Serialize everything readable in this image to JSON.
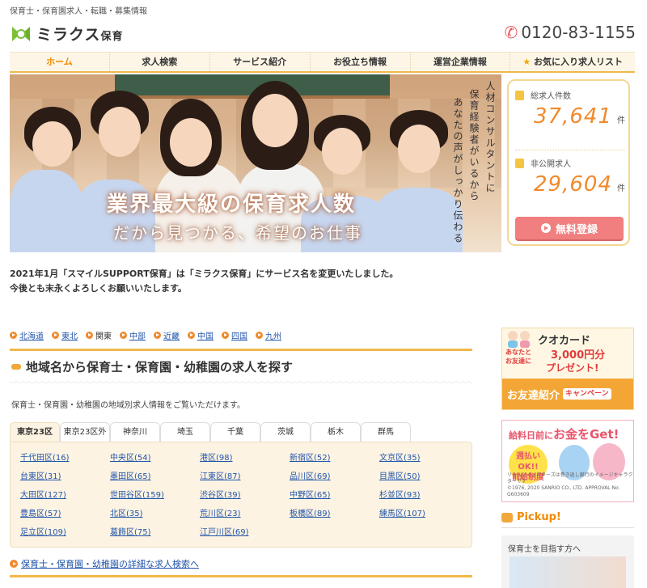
{
  "header": {
    "tagline": "保育士・保育園求人・転職・募集情報",
    "logo_text": "ミラクス",
    "logo_sub": "保育",
    "phone": "0120-83-1155"
  },
  "nav": {
    "items": [
      {
        "label": "ホーム"
      },
      {
        "label": "求人検索"
      },
      {
        "label": "サービス紹介"
      },
      {
        "label": "お役立ち情報"
      },
      {
        "label": "運営企業情報"
      },
      {
        "label": "お気に入り求人リスト"
      }
    ]
  },
  "hero": {
    "title": "業界最大級の保育求人数",
    "subtitle": "だから見つかる、希望のお仕事",
    "vertical": [
      "人材コンサルタントに",
      "保育経験者がいるから",
      "あなたの声がしっかり伝わる"
    ]
  },
  "stats": {
    "total_label": "総求人件数",
    "total_value": "37,641",
    "total_unit": "件",
    "private_label": "非公開求人",
    "private_value": "29,604",
    "private_unit": "件",
    "register_label": "無料登録"
  },
  "notice": {
    "line1": "2021年1月「スマイルSUPPORT保育」は「ミラクス保育」にサービス名を変更いたしました。",
    "line2": "今後とも末永くよろしくお願いいたします。"
  },
  "regions": [
    {
      "label": "北海道",
      "link": true
    },
    {
      "label": "東北",
      "link": true
    },
    {
      "label": "関東",
      "link": false
    },
    {
      "label": "中部",
      "link": true
    },
    {
      "label": "近畿",
      "link": true
    },
    {
      "label": "中国",
      "link": true
    },
    {
      "label": "四国",
      "link": true
    },
    {
      "label": "九州",
      "link": true
    }
  ],
  "section": {
    "title": "地域名から保育士・保育園・幼稚園の求人を探す",
    "desc": "保育士・保育園・幼稚園の地域別求人情報をご覧いただけます。"
  },
  "tabs": [
    "東京23区",
    "東京23区外",
    "神奈川",
    "埼玉",
    "千葉",
    "茨城",
    "栃木",
    "群馬"
  ],
  "wards": [
    [
      "千代田区(16)",
      "中央区(54)",
      "港区(98)",
      "新宿区(52)",
      "文京区(35)"
    ],
    [
      "台東区(31)",
      "墨田区(65)",
      "江東区(87)",
      "品川区(69)",
      "目黒区(50)"
    ],
    [
      "大田区(127)",
      "世田谷区(159)",
      "渋谷区(39)",
      "中野区(65)",
      "杉並区(93)"
    ],
    [
      "豊島区(57)",
      "北区(35)",
      "荒川区(23)",
      "板橋区(89)",
      "練馬区(107)"
    ],
    [
      "足立区(109)",
      "葛飾区(75)",
      "江戸川区(69)"
    ]
  ],
  "detail_link": "保育士・保育園・幼稚園の詳細な求人検索へ",
  "sidebar": {
    "banner1": {
      "caption": "クオカード",
      "amount": "3,000円分",
      "present": "プレゼント!",
      "small": "あなたと\nお友達に",
      "bottom": "お友達紹介",
      "camp": "キャンペーン"
    },
    "banner2": {
      "title_pre": "給料日前に",
      "title_big": "お金をGet!",
      "bubble": "週払い\nOK!!\n前給制度",
      "fine": "リトルツインスターズは巻き返し銀行のイメージキャラクターです\n©1976, 2020 SANRIO CO., LTD. APPROVAL No. G603609"
    },
    "pickup": "Pickup!",
    "pickup_card": "保育士を目指す方へ"
  },
  "colors": {
    "accent": "#f08a00",
    "gold": "#f0b84b",
    "stat_number": "#f08a2c",
    "register": "#f17f7f",
    "link": "#2255aa"
  }
}
